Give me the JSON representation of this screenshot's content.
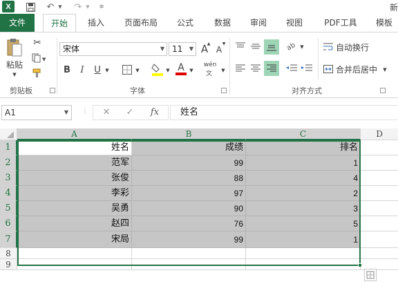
{
  "app": {
    "logo": "X",
    "title_partial": "新"
  },
  "quick_access": {
    "icons": [
      "excel-logo-icon",
      "save-icon",
      "undo-icon",
      "redo-icon",
      "customize-icon"
    ]
  },
  "tabs": [
    "文件",
    "开始",
    "插入",
    "页面布局",
    "公式",
    "数据",
    "审阅",
    "视图",
    "PDF工具",
    "模板"
  ],
  "ribbon": {
    "clipboard": {
      "paste_label": "粘贴",
      "group_label": "剪贴板"
    },
    "font": {
      "name": "宋体",
      "size": "11",
      "group_label": "字体",
      "bold": "B",
      "italic": "I",
      "underline": "U",
      "grow": "A",
      "shrink": "A",
      "font_color_label": "A",
      "highlight_color": "#ffff00",
      "font_color": "#e00000",
      "phonetic": "wén"
    },
    "alignment": {
      "wrap_text": "自动换行",
      "merge_center": "合并后居中",
      "group_label": "对齐方式"
    }
  },
  "formula_bar": {
    "name_box": "A1",
    "cancel": "✕",
    "enter": "✓",
    "fx": "fx",
    "content": "姓名"
  },
  "columns": [
    "A",
    "B",
    "C",
    "D"
  ],
  "rows": [
    "1",
    "2",
    "3",
    "4",
    "5",
    "6",
    "7",
    "8",
    "9"
  ],
  "table": [
    [
      "姓名",
      "成绩",
      "排名"
    ],
    [
      "范军",
      "99",
      "1"
    ],
    [
      "张俊",
      "88",
      "4"
    ],
    [
      "李彩",
      "97",
      "2"
    ],
    [
      "吴勇",
      "90",
      "3"
    ],
    [
      "赵四",
      "76",
      "5"
    ],
    [
      "宋局",
      "99",
      "1"
    ]
  ],
  "colors": {
    "accent": "#217346",
    "selection_fill": "#c6c6c6",
    "active_button": "#9fd5b7"
  }
}
